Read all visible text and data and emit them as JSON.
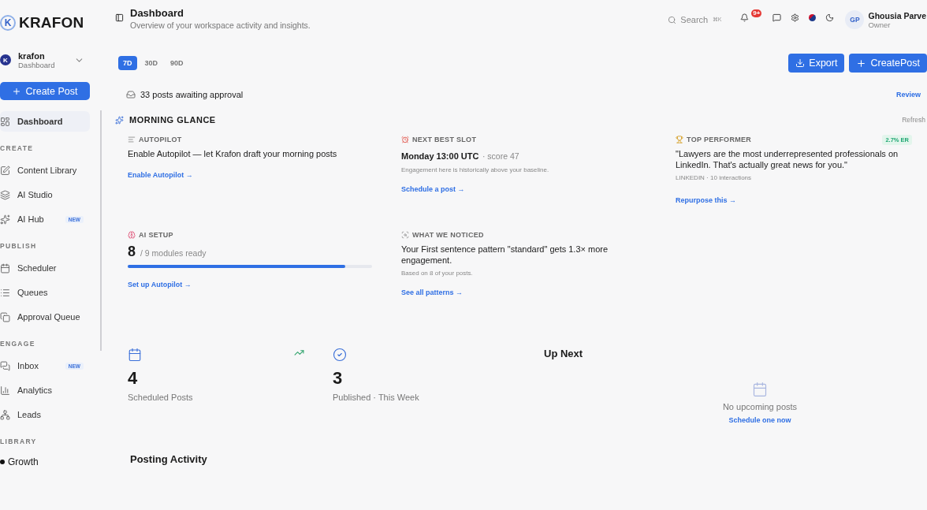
{
  "brand": {
    "initial": "K",
    "name": "KRAFON"
  },
  "header": {
    "title": "Dashboard",
    "subtitle": "Overview of your workspace activity and insights."
  },
  "search": {
    "placeholder": "Search",
    "shortcut": "⌘K"
  },
  "notifications": {
    "badge": "9+"
  },
  "user": {
    "initials": "GP",
    "name": "Ghousia Parve",
    "role": "Owner"
  },
  "workspace": {
    "initial": "K",
    "name": "krafon",
    "sub": "Dashboard"
  },
  "create_button": "Create Post",
  "nav": [
    {
      "kind": "item",
      "label": "Dashboard",
      "selected": true
    },
    {
      "kind": "section",
      "label": "CREATE"
    },
    {
      "kind": "item",
      "label": "Content Library",
      "selected": false
    },
    {
      "kind": "item",
      "label": "AI Studio",
      "selected": false
    },
    {
      "kind": "item",
      "label": "AI Hub",
      "badge": "NEW",
      "selected": false
    },
    {
      "kind": "section",
      "label": "PUBLISH"
    },
    {
      "kind": "item",
      "label": "Scheduler",
      "selected": false
    },
    {
      "kind": "item",
      "label": "Queues",
      "selected": false
    },
    {
      "kind": "item",
      "label": "Approval Queue",
      "selected": false
    },
    {
      "kind": "section",
      "label": "ENGAGE"
    },
    {
      "kind": "item",
      "label": "Inbox",
      "badge": "NEW",
      "selected": false
    },
    {
      "kind": "item",
      "label": "Analytics",
      "selected": false
    },
    {
      "kind": "item",
      "label": "Leads",
      "selected": false
    },
    {
      "kind": "section",
      "label": "LIBRARY"
    },
    {
      "kind": "group",
      "label": "Growth"
    }
  ],
  "ranges": [
    {
      "label": "7D",
      "selected": true
    },
    {
      "label": "30D",
      "selected": false
    },
    {
      "label": "90D",
      "selected": false
    }
  ],
  "actions": [
    {
      "kind": "export",
      "label": "Export"
    },
    {
      "kind": "create",
      "label": "CreatePost"
    }
  ],
  "approval": {
    "text": "33 posts awaiting approval",
    "action": "Review"
  },
  "glance": {
    "title": "MORNING GLANCE",
    "refresh": "Refresh",
    "cards": [
      {
        "kind": "autopilot",
        "label": "AUTOPILOT",
        "body": "Enable Autopilot — let Krafon draft your morning posts",
        "link": "Enable Autopilot →"
      },
      {
        "kind": "slot",
        "label": "NEXT BEST SLOT",
        "headline": "Monday 13:00 UTC",
        "meta": "· score 47",
        "note": "Engagement here is historically above your baseline.",
        "link": "Schedule a post →"
      },
      {
        "kind": "performer",
        "label": "TOP PERFORMER",
        "badge": "2.7% ER",
        "body": "\"Lawyers are the most underrepresented professionals on LinkedIn. That's actually great news for you.\"",
        "note": "LINKEDIN · 10 interactions",
        "link": "Repurpose this →"
      },
      {
        "kind": "setup",
        "label": "AI SETUP",
        "count": "8",
        "meta": "/ 9 modules ready",
        "level": 0.89,
        "link": "Set up Autopilot →"
      },
      {
        "kind": "noticed",
        "label": "WHAT WE NOTICED",
        "body": "Your First sentence pattern \"standard\" gets 1.3× more engagement.",
        "note": "Based on 8 of your posts.",
        "link": "See all patterns →"
      }
    ]
  },
  "stats": [
    {
      "kind": "scheduled",
      "value": "4",
      "label": "Scheduled Posts"
    },
    {
      "kind": "published",
      "value": "3",
      "label": "Published · This Week"
    }
  ],
  "up_next": {
    "title": "Up Next",
    "empty": "No upcoming posts",
    "link": "Schedule one now"
  },
  "posting_activity": {
    "title": "Posting Activity"
  }
}
